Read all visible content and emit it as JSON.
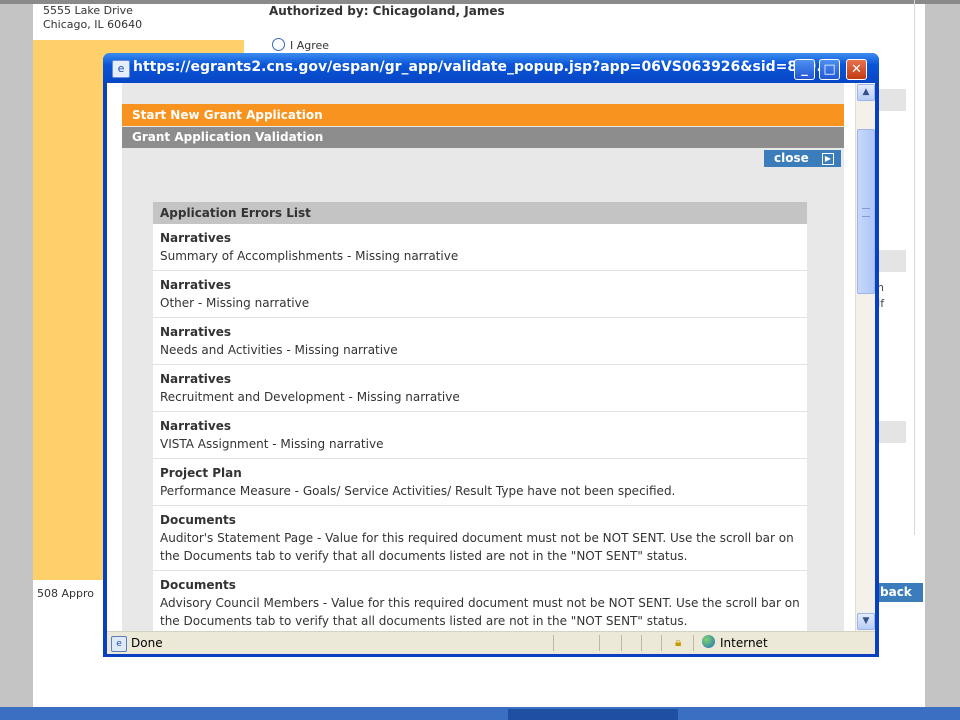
{
  "background": {
    "address_line1": "5555 Lake Drive",
    "address_line2": "Chicago, IL 60640",
    "authorized_by": "Authorized by: Chicagoland, James",
    "agree_label": "I Agree",
    "fragment_line1": "n",
    "fragment_line2": "If",
    "footer_text": "508 Appro",
    "back_label": "back"
  },
  "popup": {
    "title": "https://egrants2.cns.gov/espan/gr_app/validate_popup.jsp?app=06VS063926&sid=8a9...",
    "bar_start": "Start New Grant Application",
    "bar_validation": "Grant Application Validation",
    "close_label": "close",
    "errors_header": "Application Errors List",
    "errors": [
      {
        "title": "Narratives",
        "desc": "Summary of Accomplishments - Missing narrative"
      },
      {
        "title": "Narratives",
        "desc": "Other - Missing narrative"
      },
      {
        "title": "Narratives",
        "desc": "Needs and Activities - Missing narrative"
      },
      {
        "title": "Narratives",
        "desc": "Recruitment and Development - Missing narrative"
      },
      {
        "title": "Narratives",
        "desc": "VISTA Assignment - Missing narrative"
      },
      {
        "title": "Project Plan",
        "desc": "Performance Measure - Goals/ Service Activities/ Result Type have not been specified."
      },
      {
        "title": "Documents",
        "desc": "Auditor's Statement Page - Value for this required document must not be NOT SENT. Use the scroll bar on the Documents tab to verify that all documents listed are not in the \"NOT SENT\" status."
      },
      {
        "title": "Documents",
        "desc": "Advisory Council Members - Value for this required document must not be NOT SENT. Use the scroll bar on the Documents tab to verify that all documents listed are not in the \"NOT SENT\" status."
      }
    ],
    "status_text": "Done",
    "zone_text": "Internet"
  },
  "colors": {
    "orange": "#f7931e",
    "gray_bar": "#8d8d8d",
    "button_blue": "#3b7dbb",
    "title_blue": "#0a54d8"
  },
  "icons": [
    "ie-page-icon",
    "minimize-icon",
    "maximize-icon",
    "close-window-icon",
    "close-arrow-icon",
    "scroll-up-icon",
    "scroll-down-icon",
    "lock-icon",
    "globe-icon",
    "radio-icon"
  ]
}
